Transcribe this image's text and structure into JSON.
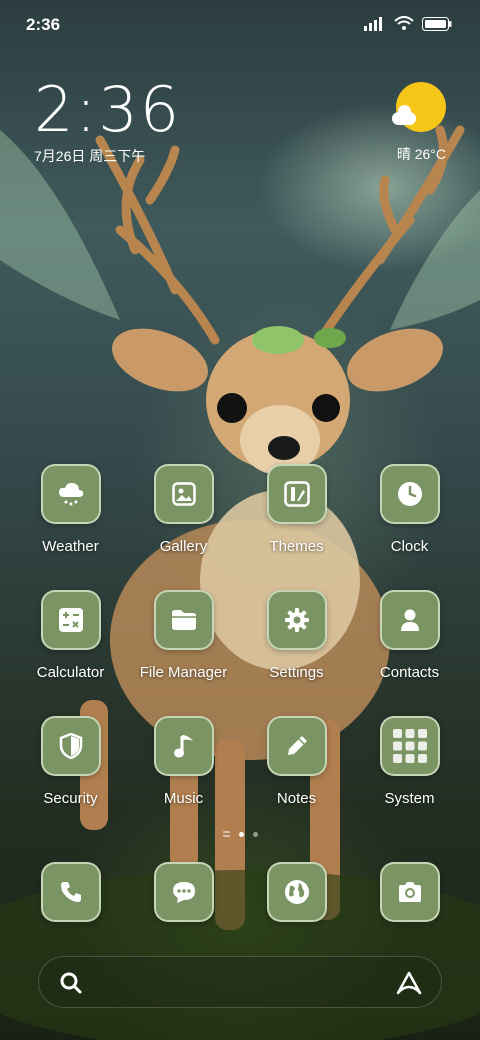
{
  "status_bar": {
    "time": "2:36",
    "icons": [
      "signal-icon",
      "wifi-icon",
      "battery-icon"
    ]
  },
  "clock_widget": {
    "time": "2:36",
    "date": "7月26日 周三下午"
  },
  "weather_widget": {
    "icon": "sun-cloud-icon",
    "text": "晴 26°C"
  },
  "apps": [
    {
      "label": "Weather",
      "icon": "weather-icon"
    },
    {
      "label": "Gallery",
      "icon": "gallery-icon"
    },
    {
      "label": "Themes",
      "icon": "themes-icon"
    },
    {
      "label": "Clock",
      "icon": "clock-icon"
    },
    {
      "label": "Calculator",
      "icon": "calculator-icon"
    },
    {
      "label": "File Manager",
      "icon": "folder-icon"
    },
    {
      "label": "Settings",
      "icon": "gear-icon"
    },
    {
      "label": "Contacts",
      "icon": "person-icon"
    },
    {
      "label": "Security",
      "icon": "shield-icon"
    },
    {
      "label": "Music",
      "icon": "music-note-icon"
    },
    {
      "label": "Notes",
      "icon": "pencil-icon"
    },
    {
      "label": "System",
      "icon": "folder-grid-icon"
    }
  ],
  "page_indicator": {
    "pages": 2,
    "active": 1
  },
  "dock": [
    {
      "icon": "phone-icon"
    },
    {
      "icon": "chat-icon"
    },
    {
      "icon": "globe-icon"
    },
    {
      "icon": "camera-icon"
    }
  ],
  "search_bar": {
    "left_icon": "search-icon",
    "right_icon": "assistant-icon"
  },
  "colors": {
    "icon_bg": "#7b9464",
    "icon_border": "#d2e1c3",
    "sun": "#f5c518"
  }
}
